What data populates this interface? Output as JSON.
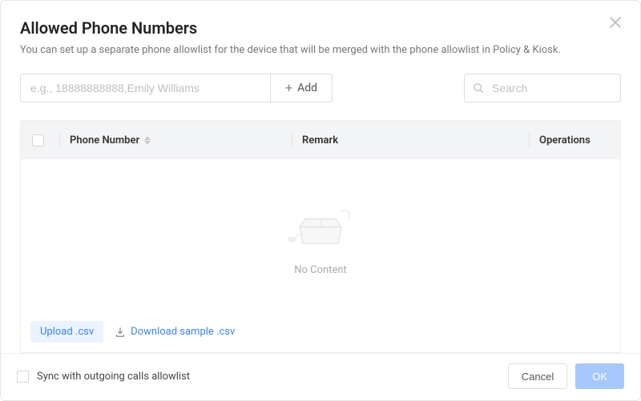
{
  "header": {
    "title": "Allowed Phone Numbers",
    "subtitle": "You can set up a separate phone allowlist for the device that will be merged with the phone allowlist in Policy & Kiosk."
  },
  "controls": {
    "phone_input_placeholder": "e.g., 18888888888,Emily Williams",
    "phone_input_value": "",
    "add_label": "Add",
    "search_placeholder": "Search",
    "search_value": ""
  },
  "table": {
    "columns": {
      "phone": "Phone Number",
      "remark": "Remark",
      "operations": "Operations"
    },
    "rows": [],
    "empty_text": "No Content"
  },
  "actions": {
    "upload_label": "Upload .csv",
    "download_label": "Download sample .csv"
  },
  "footer": {
    "sync_label": "Sync with outgoing calls allowlist",
    "cancel_label": "Cancel",
    "ok_label": "OK"
  }
}
